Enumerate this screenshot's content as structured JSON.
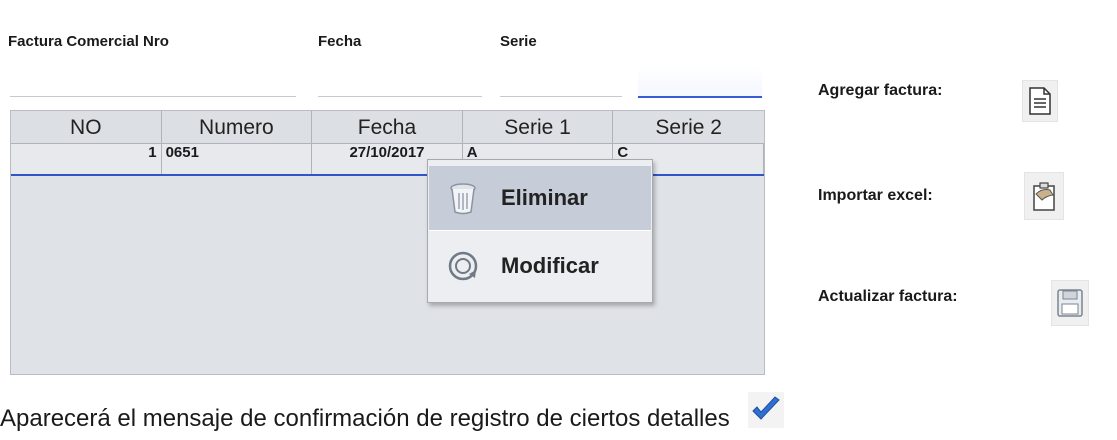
{
  "form": {
    "factura_label": "Factura Comercial Nro",
    "fecha_label": "Fecha",
    "serie_label": "Serie"
  },
  "table": {
    "headers": [
      "NO",
      "Numero",
      "Fecha",
      "Serie 1",
      "Serie 2"
    ],
    "rows": [
      {
        "no": "1",
        "numero": "0651",
        "fecha": "27/10/2017",
        "serie1": "A",
        "serie2": "C"
      }
    ]
  },
  "context_menu": {
    "items": [
      {
        "label": "Eliminar",
        "icon": "trash-icon"
      },
      {
        "label": "Modificar",
        "icon": "refresh-icon"
      }
    ]
  },
  "side": {
    "agregar_label": "Agregar factura:",
    "importar_label": "Importar excel:",
    "actualizar_label": "Actualizar factura:"
  },
  "bottom": {
    "text": "Aparecerá el mensaje de confirmación de registro de ciertos detalles"
  },
  "colors": {
    "selection_line": "#2f55c9",
    "confirm_check": "#2f6fd1"
  }
}
